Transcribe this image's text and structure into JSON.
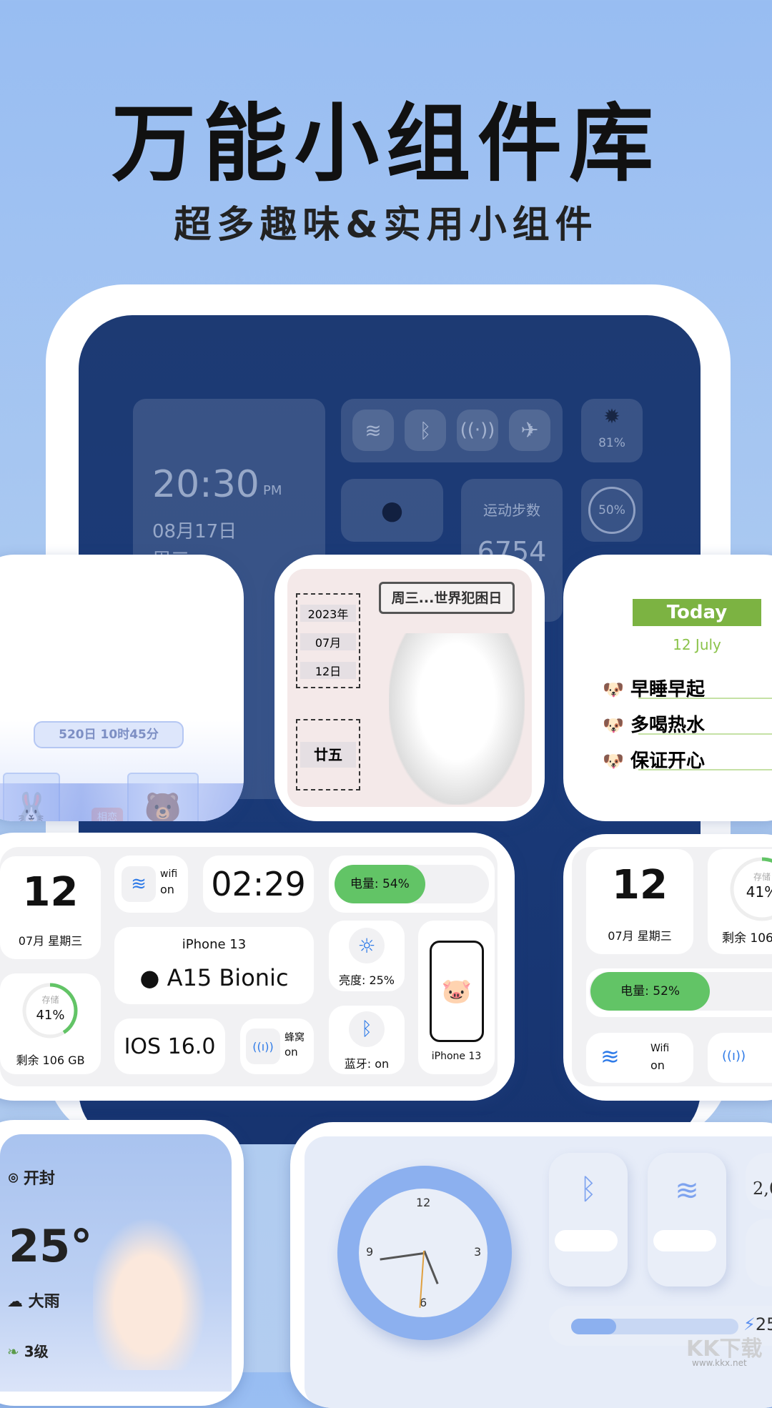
{
  "header": {
    "title": "万能小组件库",
    "subtitle": "超多趣味&实用小组件"
  },
  "dark_widgets": {
    "time": "20:30",
    "ampm": "PM",
    "date": "08月17日",
    "weekday": "周三",
    "brightness": "81%",
    "steps_label": "运动步数",
    "steps": "6754",
    "ring": "50%"
  },
  "couple": {
    "left_name": "兔兔",
    "right_name": "熊熊",
    "badge": "相恋",
    "duration": "520日 10时45分"
  },
  "calendar_girl": {
    "bubble": "周三...世界犯困日",
    "year": "2023年",
    "month": "07月",
    "day": "12日",
    "lunar": "廿五"
  },
  "todo": {
    "banner": "Today",
    "date": "12  July",
    "items": [
      "早睡早起",
      "多喝热水",
      "保证开心"
    ]
  },
  "status_widget": {
    "day": "12",
    "date": "07月 星期三",
    "wifi_label": "wifi",
    "wifi_state": "on",
    "time": "02:29",
    "battery": "电量: 54%",
    "battery_level": 54,
    "storage_label": "存储",
    "storage": "41%",
    "storage_level": 41,
    "storage_free": "剩余 106 GB",
    "model": "iPhone 13",
    "chip": "A15 Bionic",
    "os": "IOS 16.0",
    "cell_label": "蜂窝",
    "cell_state": "on",
    "brightness": "亮度: 25%",
    "bluetooth": "蓝牙:  on",
    "phone_label": "iPhone 13"
  },
  "status_widget_2": {
    "day": "12",
    "date": "07月 星期三",
    "storage_label": "存储",
    "storage": "41%",
    "storage_free": "剩余 106",
    "battery": "电量: 52%",
    "battery_level": 52,
    "wifi_label": "Wifi",
    "wifi_state": "on"
  },
  "weather": {
    "city": "开封",
    "temp": "25°",
    "condition": "大雨",
    "wind": "3级"
  },
  "neumorphic": {
    "clock_numbers": [
      "12",
      "3",
      "6",
      "9"
    ],
    "third_value": "2,0",
    "charge": "25",
    "charge_level": 27
  },
  "watermark": {
    "text": "KK下载",
    "url": "www.kkx.net"
  },
  "colors": {
    "accent_green": "#62c466",
    "accent_blue": "#8cb0ef",
    "todo_green": "#7cb342"
  }
}
